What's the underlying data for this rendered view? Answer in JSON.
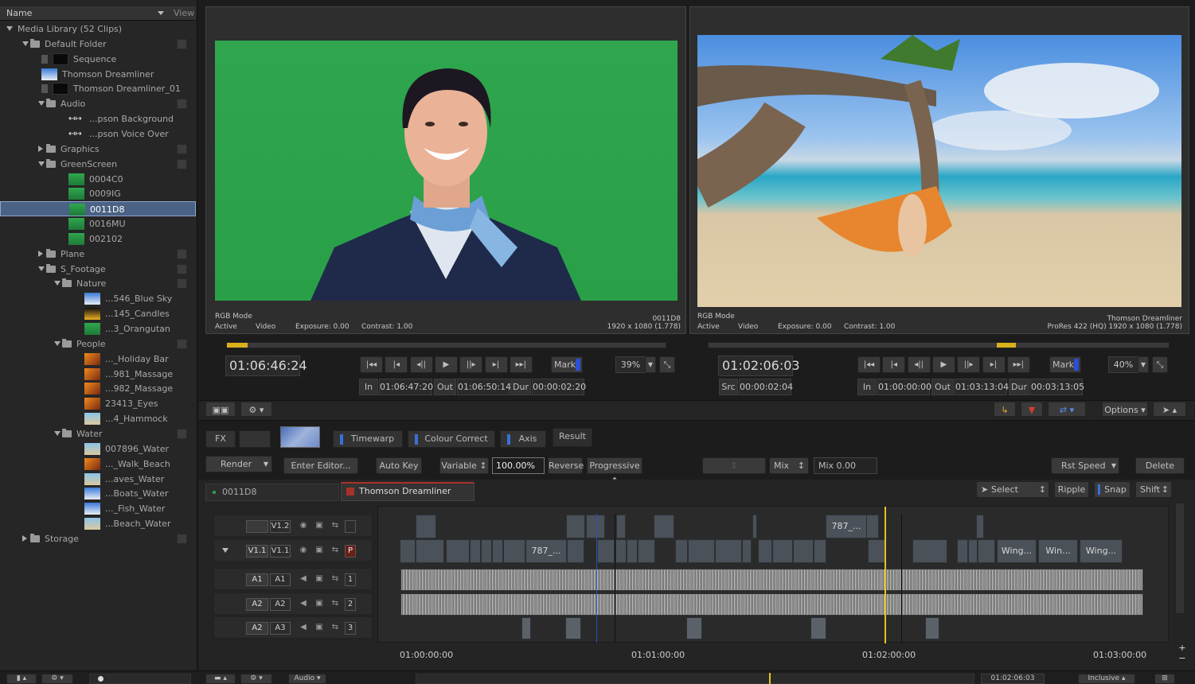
{
  "library": {
    "name_header": "Name",
    "view_label": "View",
    "rows": [
      {
        "label": "Media Library (52 Clips)",
        "indent": 8,
        "tri": "down",
        "icon": "none"
      },
      {
        "label": "Default Folder",
        "indent": 28,
        "tri": "down",
        "icon": "folder",
        "chk": true
      },
      {
        "label": "Sequence",
        "indent": 52,
        "icon": "sequence"
      },
      {
        "label": "Thomson Dreamliner",
        "indent": 52,
        "icon": "sky"
      },
      {
        "label": "Thomson Dreamliner_01",
        "indent": 52,
        "icon": "sequence"
      },
      {
        "label": "Audio",
        "indent": 48,
        "tri": "down",
        "icon": "folder",
        "chk": true
      },
      {
        "label": "...pson Background",
        "indent": 86,
        "icon": "audio"
      },
      {
        "label": "...pson Voice Over",
        "indent": 86,
        "icon": "audio"
      },
      {
        "label": "Graphics",
        "indent": 48,
        "tri": "right",
        "icon": "folder",
        "chk": true
      },
      {
        "label": "GreenScreen",
        "indent": 48,
        "tri": "down",
        "icon": "folder",
        "chk": true
      },
      {
        "label": "0004C0",
        "indent": 86,
        "icon": "green"
      },
      {
        "label": "0009IG",
        "indent": 86,
        "icon": "green"
      },
      {
        "label": "0011D8",
        "indent": 86,
        "icon": "green",
        "selected": true
      },
      {
        "label": "0016MU",
        "indent": 86,
        "icon": "green"
      },
      {
        "label": "002102",
        "indent": 86,
        "icon": "green"
      },
      {
        "label": "Plane",
        "indent": 48,
        "tri": "right",
        "icon": "folder",
        "chk": true
      },
      {
        "label": "S_Footage",
        "indent": 48,
        "tri": "down",
        "icon": "folder",
        "chk": true
      },
      {
        "label": "Nature",
        "indent": 68,
        "tri": "down",
        "icon": "folder",
        "chk": true
      },
      {
        "label": "...546_Blue Sky",
        "indent": 106,
        "icon": "sky"
      },
      {
        "label": "...145_Candles",
        "indent": 106,
        "icon": "candle"
      },
      {
        "label": "...3_Orangutan",
        "indent": 106,
        "icon": "green"
      },
      {
        "label": "People",
        "indent": 68,
        "tri": "down",
        "icon": "folder",
        "chk": true
      },
      {
        "label": "..._Holiday Bar",
        "indent": 106,
        "icon": "warm"
      },
      {
        "label": "...981_Massage",
        "indent": 106,
        "icon": "warm"
      },
      {
        "label": "...982_Massage",
        "indent": 106,
        "icon": "warm"
      },
      {
        "label": "23413_Eyes",
        "indent": 106,
        "icon": "warm"
      },
      {
        "label": "...4_Hammock",
        "indent": 106,
        "icon": "beach"
      },
      {
        "label": "Water",
        "indent": 68,
        "tri": "down",
        "icon": "folder",
        "chk": true
      },
      {
        "label": "007896_Water",
        "indent": 106,
        "icon": "beach"
      },
      {
        "label": "..._Walk_Beach",
        "indent": 106,
        "icon": "warm"
      },
      {
        "label": "...aves_Water",
        "indent": 106,
        "icon": "beach"
      },
      {
        "label": "...Boats_Water",
        "indent": 106,
        "icon": "sky"
      },
      {
        "label": "..._Fish_Water",
        "indent": 106,
        "icon": "sky"
      },
      {
        "label": "...Beach_Water",
        "indent": 106,
        "icon": "beach"
      },
      {
        "label": "Storage",
        "indent": 28,
        "tri": "right",
        "icon": "folder",
        "chk": true
      }
    ]
  },
  "source_viewer": {
    "mode": "RGB Mode",
    "active": "Active",
    "video": "Video",
    "exposure": "Exposure: 0.00",
    "contrast": "Contrast: 1.00",
    "clip_name": "0011D8",
    "resolution": "1920 x 1080 (1.778)",
    "timecode": "01:06:46:24",
    "in_label": "In",
    "in_tc": "01:06:47:20",
    "out_label": "Out",
    "out_tc": "01:06:50:14",
    "dur_label": "Dur",
    "dur_tc": "00:00:02:20",
    "mark": "Mark",
    "zoom": "39%"
  },
  "record_viewer": {
    "mode": "RGB Mode",
    "active": "Active",
    "video": "Video",
    "exposure": "Exposure: 0.00",
    "contrast": "Contrast: 1.00",
    "clip_name": "Thomson Dreamliner",
    "resolution": "ProRes 422 (HQ) 1920 x 1080 (1.778)",
    "timecode": "01:02:06:03",
    "src_label": "Src",
    "src_tc": "00:00:02:04",
    "in_label": "In",
    "in_tc": "01:00:00:00",
    "out_label": "Out",
    "out_tc": "01:03:13:04",
    "dur_label": "Dur",
    "dur_tc": "00:03:13:05",
    "mark": "Mark",
    "zoom": "40%"
  },
  "effects": {
    "fx": "FX",
    "tabs": [
      "Timewarp",
      "Colour Correct",
      "Axis"
    ],
    "result": "Result",
    "render": "Render",
    "enter_editor": "Enter Editor...",
    "auto_key": "Auto Key",
    "variable": "Variable",
    "speed": "100.00%",
    "reverse": "Reverse",
    "progressive": "Progressive",
    "mix": "Mix",
    "mix_value": "Mix 0.00",
    "rst_speed": "Rst Speed",
    "delete": "Delete",
    "options": "Options"
  },
  "timeline": {
    "tab_source": "0011D8",
    "tab_record": "Thomson Dreamliner",
    "select": "Select",
    "ripple": "Ripple",
    "snap": "Snap",
    "shift": "Shift",
    "tracks": [
      {
        "a": "",
        "b": "V1.2",
        "num": ""
      },
      {
        "a": "V1.1",
        "b": "V1.1",
        "num": "P"
      },
      {
        "a": "A1",
        "b": "A1",
        "num": "1"
      },
      {
        "a": "A2",
        "b": "A2",
        "num": "2"
      },
      {
        "a": "A2",
        "b": "A3",
        "num": "3"
      }
    ],
    "clip_labels": {
      "v12": "787_...",
      "v11a": "787_...",
      "w1": "Wing...",
      "w2": "Win...",
      "w3": "Wing..."
    },
    "ruler": [
      "01:00:00:00",
      "01:01:00:00",
      "01:02:00:00",
      "01:03:00:00"
    ],
    "bottom_tc": "01:02:06:03",
    "audio_label": "Audio",
    "inclusive": "Inclusive"
  },
  "colors": {
    "accent": "#3a6fd8",
    "playhead": "#e8c21a",
    "green": "#2fa64e",
    "rec_red": "#a8322a"
  }
}
